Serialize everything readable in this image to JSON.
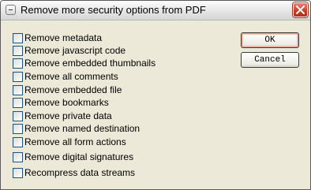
{
  "window": {
    "title": "Remove more security options from PDF"
  },
  "options": [
    {
      "label": "Remove metadata",
      "checked": false
    },
    {
      "label": "Remove javascript code",
      "checked": false
    },
    {
      "label": "Remove embedded thumbnails",
      "checked": false
    },
    {
      "label": "Remove all comments",
      "checked": false
    },
    {
      "label": "Remove embedded file",
      "checked": false
    },
    {
      "label": "Remove bookmarks",
      "checked": false
    },
    {
      "label": "Remove private data",
      "checked": false
    },
    {
      "label": "Remove named destination",
      "checked": false
    },
    {
      "label": "Remove all form actions",
      "checked": false
    },
    {
      "label": "Remove digital signatures",
      "checked": false
    },
    {
      "label": "Recompress data streams",
      "checked": false
    }
  ],
  "buttons": {
    "ok_label": "OK",
    "cancel_label": "Cancel"
  },
  "icons": {
    "system_menu": "system-menu-icon",
    "close": "close-icon"
  },
  "colors": {
    "dialog_background": "#ece9d8",
    "close_button": "#c8402a",
    "checkbox_border": "#1c5180"
  }
}
